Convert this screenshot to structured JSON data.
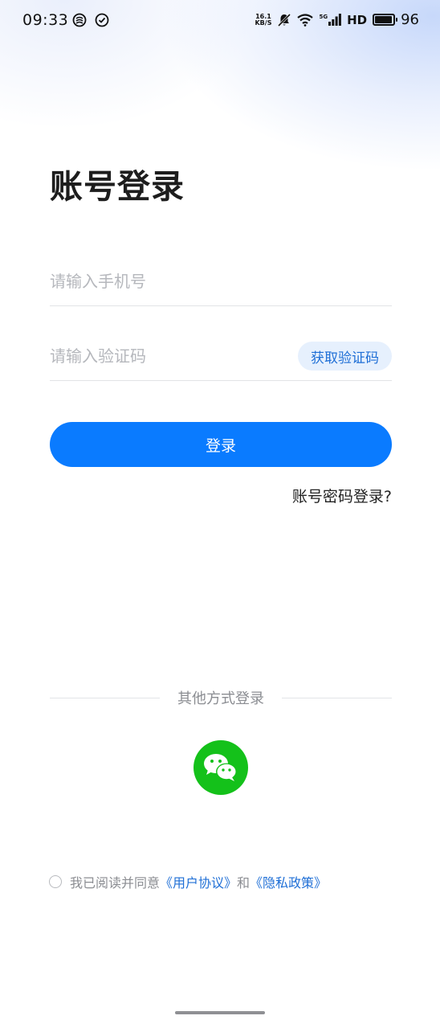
{
  "status_bar": {
    "time": "09:33",
    "network_speed_value": "16.1",
    "network_speed_unit": "KB/S",
    "signal_type": "5G",
    "hd_label": "HD",
    "battery_level": "96",
    "battery_fraction": 0.96
  },
  "page": {
    "title": "账号登录"
  },
  "form": {
    "phone_placeholder": "请输入手机号",
    "code_placeholder": "请输入验证码",
    "get_code_label": "获取验证码",
    "login_label": "登录",
    "password_login_label": "账号密码登录?"
  },
  "other_login": {
    "divider_label": "其他方式登录"
  },
  "agreement": {
    "prefix": "我已阅读并同意",
    "user_agreement": "《用户协议》",
    "and": "和",
    "privacy_policy": "《隐私政策》"
  },
  "colors": {
    "primary": "#0a7bff",
    "wechat": "#14c11a",
    "link": "#1f6fd6"
  }
}
